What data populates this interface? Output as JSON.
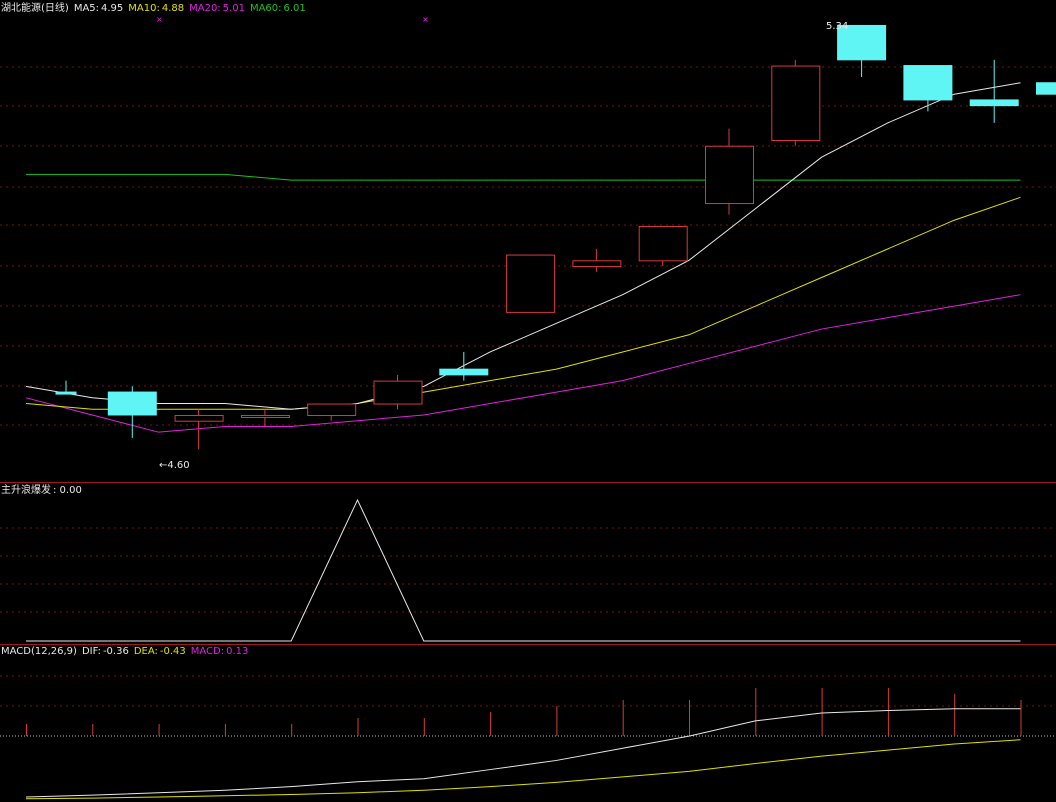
{
  "colors": {
    "background": "#000000",
    "up": "#d83a3a",
    "down": "#5ff5f5",
    "ma5": "#e8e8e8",
    "ma10": "#e0e000",
    "ma20": "#e020e0",
    "ma60": "#20c020",
    "separator": "#a01818",
    "grid": "#7a1010",
    "text": "#e8e8e8",
    "macd_bar_up": "#d83a3a"
  },
  "header": {
    "stock_title": "湖北能源(日线)",
    "ma5_label": "MA5:",
    "ma5_value": "4.95",
    "ma10_label": "MA10:",
    "ma10_value": "4.88",
    "ma20_label": "MA20:",
    "ma20_value": "5.01",
    "ma60_label": "MA60:",
    "ma60_value": "6.01"
  },
  "indicator": {
    "label": "主升浪爆发",
    "value": ": 0.00"
  },
  "macd_header": {
    "label": "MACD(12,26,9)",
    "dif_label": "DIF:",
    "dif_value": "-0.36",
    "dea_label": "DEA:",
    "dea_value": "-0.43",
    "macd_label": "MACD:",
    "macd_value": "0.13"
  },
  "annotations": {
    "low_label": "4.60",
    "high_label": "5.34"
  },
  "chart_data": {
    "type": "candlestick",
    "price_range": [
      4.55,
      5.36
    ],
    "candles": [
      {
        "open": 4.7,
        "high": 4.72,
        "low": 4.7,
        "close": 4.7,
        "dir": "down"
      },
      {
        "open": 4.7,
        "high": 4.71,
        "low": 4.62,
        "close": 4.66,
        "dir": "down"
      },
      {
        "open": 4.65,
        "high": 4.67,
        "low": 4.6,
        "close": 4.66,
        "dir": "up"
      },
      {
        "open": 4.66,
        "high": 4.67,
        "low": 4.64,
        "close": 4.66,
        "dir": "up"
      },
      {
        "open": 4.66,
        "high": 4.68,
        "low": 4.65,
        "close": 4.68,
        "dir": "up"
      },
      {
        "open": 4.68,
        "high": 4.73,
        "low": 4.67,
        "close": 4.72,
        "dir": "up"
      },
      {
        "open": 4.74,
        "high": 4.77,
        "low": 4.72,
        "close": 4.73,
        "dir": "down"
      },
      {
        "open": 4.84,
        "high": 4.94,
        "low": 4.84,
        "close": 4.94,
        "dir": "up"
      },
      {
        "open": 4.92,
        "high": 4.95,
        "low": 4.91,
        "close": 4.93,
        "dir": "up"
      },
      {
        "open": 4.93,
        "high": 4.99,
        "low": 4.92,
        "close": 4.99,
        "dir": "up"
      },
      {
        "open": 5.03,
        "high": 5.16,
        "low": 5.01,
        "close": 5.13,
        "dir": "up"
      },
      {
        "open": 5.14,
        "high": 5.28,
        "low": 5.13,
        "close": 5.27,
        "dir": "up"
      },
      {
        "open": 5.34,
        "high": 5.34,
        "low": 5.25,
        "close": 5.28,
        "dir": "down"
      },
      {
        "open": 5.27,
        "high": 5.27,
        "low": 5.19,
        "close": 5.21,
        "dir": "down"
      },
      {
        "open": 5.21,
        "high": 5.28,
        "low": 5.17,
        "close": 5.2,
        "dir": "down"
      },
      {
        "open": 5.24,
        "high": 5.24,
        "low": 5.17,
        "close": 5.22,
        "dir": "down"
      }
    ],
    "ma5": [
      4.71,
      4.69,
      4.68,
      4.68,
      4.67,
      4.68,
      4.71,
      4.77,
      4.82,
      4.87,
      4.93,
      5.02,
      5.11,
      5.17,
      5.22,
      5.24
    ],
    "ma10": [
      4.68,
      4.67,
      4.67,
      4.67,
      4.67,
      4.68,
      4.7,
      4.72,
      4.74,
      4.77,
      4.8,
      4.85,
      4.9,
      4.95,
      5.0,
      5.04
    ],
    "ma20": [
      4.69,
      4.66,
      4.63,
      4.64,
      4.64,
      4.65,
      4.66,
      4.68,
      4.7,
      4.72,
      4.75,
      4.78,
      4.81,
      4.83,
      4.85,
      4.87
    ],
    "ma60": [
      5.08,
      5.08,
      5.08,
      5.08,
      5.07,
      5.07,
      5.07,
      5.07,
      5.07,
      5.07,
      5.07,
      5.07,
      5.07,
      5.07,
      5.07,
      5.07
    ],
    "indicator_range": [
      0,
      1
    ],
    "indicator_values": [
      0,
      0,
      0,
      0,
      0,
      1,
      0,
      0,
      0,
      0,
      0,
      0,
      0,
      0,
      0,
      0
    ],
    "macd_range": [
      -1.4,
      0.9
    ],
    "macd_bars": [
      0.2,
      0.2,
      0.2,
      0.2,
      0.2,
      0.3,
      0.3,
      0.4,
      0.5,
      0.6,
      0.6,
      0.8,
      0.8,
      0.8,
      0.7,
      0.6
    ],
    "dif": [
      -1.35,
      -1.32,
      -1.28,
      -1.24,
      -1.18,
      -1.1,
      -1.05,
      -0.9,
      -0.75,
      -0.55,
      -0.35,
      -0.1,
      0.03,
      0.07,
      0.1,
      0.1
    ],
    "dea": [
      -1.38,
      -1.37,
      -1.35,
      -1.33,
      -1.31,
      -1.28,
      -1.24,
      -1.18,
      -1.11,
      -1.02,
      -0.93,
      -0.8,
      -0.68,
      -0.58,
      -0.48,
      -0.41
    ]
  }
}
